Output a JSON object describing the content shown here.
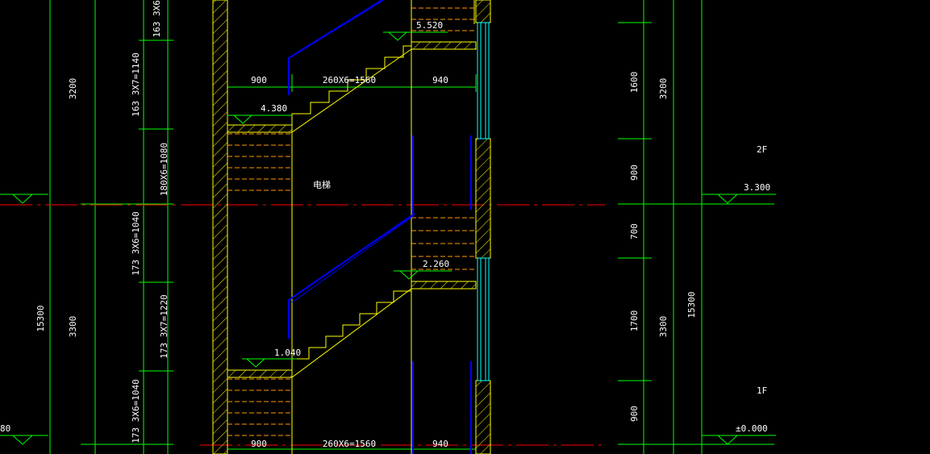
{
  "drawing": {
    "background": "#000000",
    "colors": {
      "dimension": "#00ff00",
      "wall": "#ffff00",
      "axis": "#ff0000",
      "handrail": "#0000ff",
      "window": "#00ffff",
      "text": "#ffffff",
      "tread": "#ff9900"
    },
    "left_total_dim": "15300",
    "right_total_dim": "15300",
    "left_floor_dims": [
      "3200",
      "3300"
    ],
    "right_floor_dims": [
      "3200",
      "3300"
    ],
    "left_stair_dims": [
      "163 3X6=",
      "163 3X7=1140",
      "180X6=1080",
      "173 3X6=1040",
      "173 3X7=1220",
      "173 3X6=1040"
    ],
    "right_small_dims": [
      "1600",
      "900",
      "700",
      "1700",
      "900"
    ],
    "top_dims": [
      "900",
      "260X6=1560",
      "940"
    ],
    "bottom_dims": [
      "900",
      "260X6=1560",
      "940"
    ],
    "landing_levels": [
      "5.520",
      "4.380",
      "2.260",
      "1.040"
    ],
    "floor_levels": [
      "3.300",
      "±0.000"
    ],
    "floor_names": [
      "2F",
      "1F"
    ],
    "edge_fragment": "80",
    "room_label": "电梯"
  }
}
